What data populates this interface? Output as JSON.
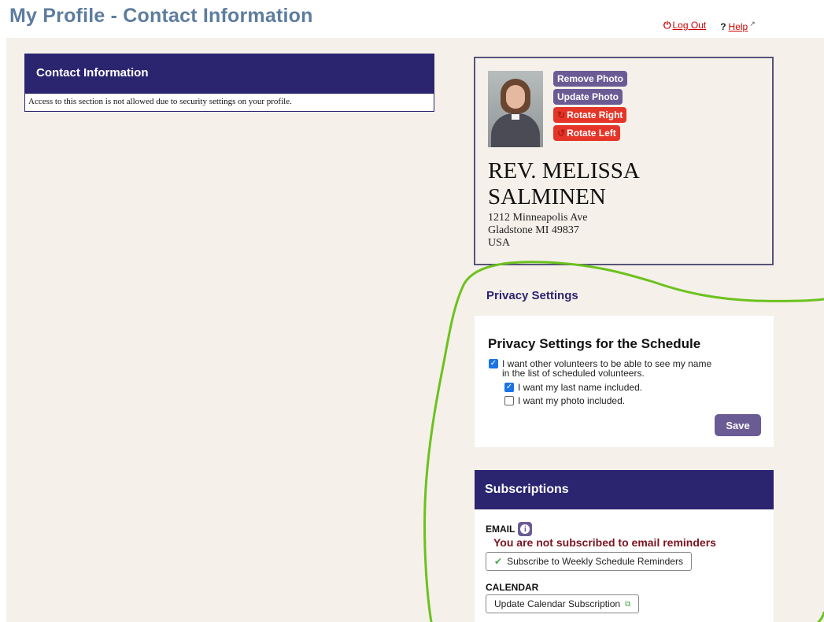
{
  "header": {
    "title": "My Profile - Contact Information",
    "logout_label": "Log Out",
    "help_label": "Help"
  },
  "contact": {
    "heading": "Contact Information",
    "message": "Access to this section is not allowed due to security settings on your profile."
  },
  "profile": {
    "remove_photo": "Remove Photo",
    "update_photo": "Update Photo",
    "rotate_right": "Rotate Right",
    "rotate_left": "Rotate Left",
    "name_line1": "REV. MELISSA",
    "name_line2": "SALMINEN",
    "address_line1": "1212 Minneapolis Ave",
    "address_line2": "Gladstone MI 49837",
    "address_line3": "USA"
  },
  "privacy": {
    "heading": "Privacy Settings",
    "box_title": "Privacy Settings for the Schedule",
    "option_show_name_line1": "I want other volunteers to be able to see my name",
    "option_show_name_line2": "in the list of scheduled volunteers.",
    "option_last_name": "I want my last name included.",
    "option_photo": "I want my photo included.",
    "save_label": "Save"
  },
  "subscriptions": {
    "heading": "Subscriptions",
    "email_label": "EMAIL",
    "not_subscribed": "You are not subscribed to email reminders",
    "subscribe_button": "Subscribe to Weekly Schedule Reminders",
    "calendar_label": "CALENDAR",
    "calendar_button": "Update Calendar Subscription"
  },
  "colors": {
    "brand_navy": "#2b2570",
    "button_purple": "#6b5b95",
    "button_red": "#e53528",
    "title_blue": "#5d7d9e",
    "annotation_green": "#6cc21e"
  }
}
